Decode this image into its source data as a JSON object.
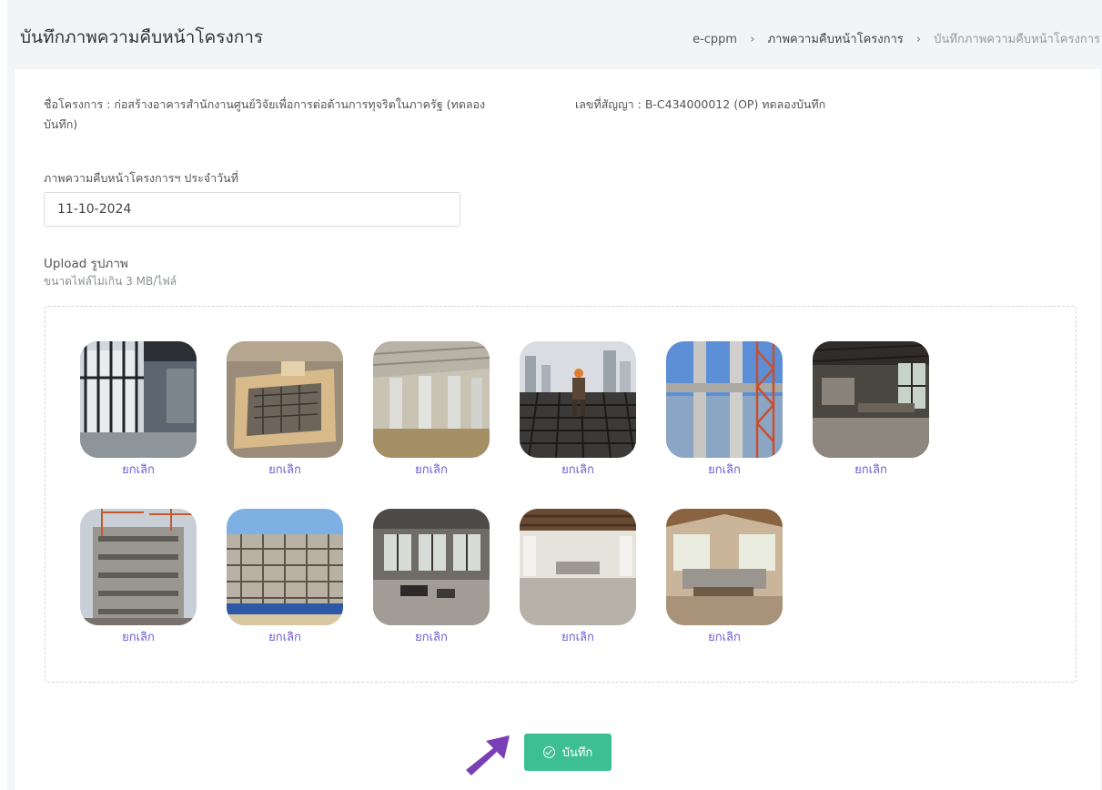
{
  "header": {
    "title": "บันทึกภาพความคืบหน้าโครงการ",
    "breadcrumb": [
      "e-cppm",
      "ภาพความคืบหน้าโครงการ",
      "บันทึกภาพความคืบหน้าโครงการ"
    ]
  },
  "project": {
    "name_line1": "ชื่อโครงการ : ก่อสร้างอาคารสำนักงานศูนย์วิจัยเพื่อการต่อต้านการทุจริตในภาครัฐ (ทดลอง",
    "name_line2": "บันทึก)",
    "contract": "เลขที่สัญญา : B-C434000012 (OP) ทดลองบันทึก"
  },
  "date_field": {
    "label": "ภาพความคืบหน้าโครงการฯ ประจำวันที่",
    "value": "11-10-2024"
  },
  "upload": {
    "title": "Upload รูปภาพ",
    "hint": "ขนาดไฟล์ไม่เกิน 3 MB/ไฟล์",
    "cancel_label": "ยกเลิก",
    "images": [
      {
        "subject": "glass-lobby"
      },
      {
        "subject": "foundation-formwork"
      },
      {
        "subject": "column-structure"
      },
      {
        "subject": "rebar-worker"
      },
      {
        "subject": "concrete-columns-crane"
      },
      {
        "subject": "industrial-kitchen"
      },
      {
        "subject": "high-rise-construction"
      },
      {
        "subject": "scaffolded-building"
      },
      {
        "subject": "industrial-loft-lounge"
      },
      {
        "subject": "empty-living-room"
      },
      {
        "subject": "furnished-living-room"
      }
    ]
  },
  "actions": {
    "save_label": "บันทึก"
  },
  "colors": {
    "accent": "#3ebf93",
    "cancel_link": "#6c5bd4",
    "pointer_arrow": "#7a3fb5"
  }
}
